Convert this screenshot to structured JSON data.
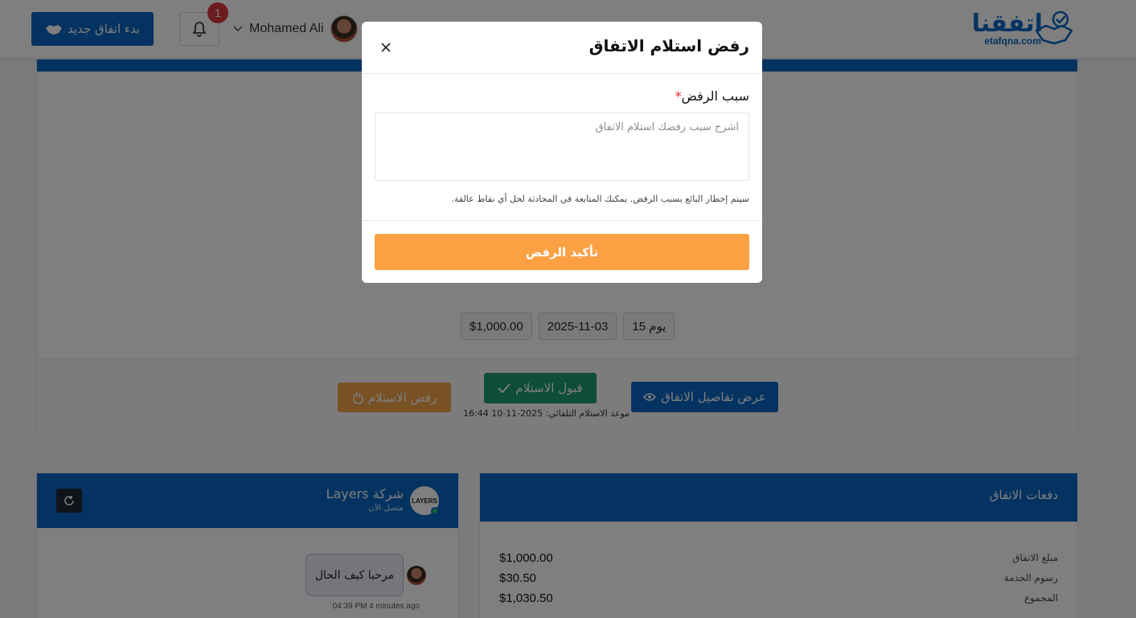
{
  "header": {
    "logo_text": "اتفقنا",
    "logo_domain": "etafqna.com",
    "new_deal_label": "بدء اتفاق جديد",
    "notification_count": "1",
    "user_name": "Mohamed Ali"
  },
  "deal": {
    "pills": [
      "$1,000.00",
      "2025-11-03",
      "15 يوم"
    ],
    "reject_label": "رفض الاستلام",
    "accept_label": "قبول الاستلام",
    "auto_accept_text": "موعد الاستلام التلقائي: 2025-11-10 16:44",
    "details_label": "عرض تفاصيل الاتفاق"
  },
  "chat": {
    "company_name": "شركة Layers",
    "company_logo_text": "LAYERS",
    "status": "متصل الآن",
    "message_text": "مرحبا كيف الحال",
    "message_time": "04:39 PM   4 minutes ago"
  },
  "payments": {
    "title": "دفعات الاتفاق",
    "rows": [
      {
        "label": "مبلغ الاتفاق",
        "value": "$1,000.00"
      },
      {
        "label": "رسوم الخدمة",
        "value": "$30.50"
      },
      {
        "label": "المجموع",
        "value": "$1,030.50"
      }
    ]
  },
  "modal": {
    "title": "رفض استلام الاتفاق",
    "field_label": "سبب الرفض",
    "required_mark": "*",
    "placeholder": "اشرح سبب رفضك استلام الاتفاق",
    "hint": "سيتم إخطار البائع بسبب الرفض. يمكنك المتابعة في المحادثة لحل أي نقاط عالقة.",
    "confirm_label": "تأكيد الرفض"
  },
  "colors": {
    "primary": "#0b66c3",
    "confirm": "#fba043",
    "success": "#1d9a6c",
    "danger": "#d9363e"
  }
}
